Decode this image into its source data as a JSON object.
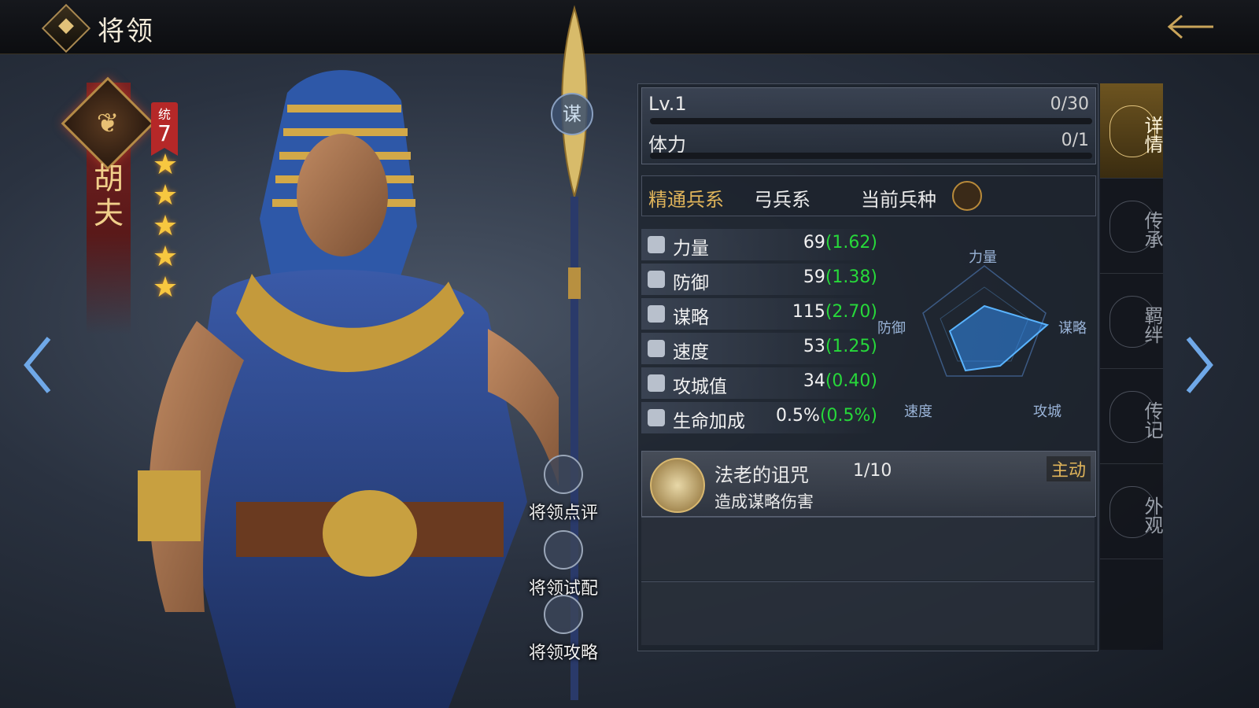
{
  "header": {
    "title": "将领",
    "back_icon": "arrow-left-icon"
  },
  "hero": {
    "name": "胡夫",
    "tong_label": "统",
    "tong_value": "7",
    "stars": 5,
    "skill_type_badge": "谋",
    "actions": [
      {
        "label": "将领点评",
        "icon": "comment-icon"
      },
      {
        "label": "将领试配",
        "icon": "helmet-icon"
      },
      {
        "label": "将领攻略",
        "icon": "book-icon"
      }
    ]
  },
  "level": {
    "label": "Lv.1",
    "exp": "0/30",
    "exp_fraction": 0
  },
  "stamina": {
    "label": "体力",
    "value": "0/1",
    "fraction": 0
  },
  "troop": {
    "mastery_label": "精通兵系",
    "mastery_value": "弓兵系",
    "current_label": "当前兵种",
    "current_icon": "bow-icon"
  },
  "stats": [
    {
      "name": "力量",
      "value": "69",
      "growth": "(1.62)",
      "icon": "fist-icon"
    },
    {
      "name": "防御",
      "value": "59",
      "growth": "(1.38)",
      "icon": "shield-icon"
    },
    {
      "name": "谋略",
      "value": "115",
      "growth": "(2.70)",
      "icon": "book-icon"
    },
    {
      "name": "速度",
      "value": "53",
      "growth": "(1.25)",
      "icon": "boot-icon"
    },
    {
      "name": "攻城值",
      "value": "34",
      "growth": "(0.40)",
      "icon": "ram-icon"
    },
    {
      "name": "生命加成",
      "value": "0.5%",
      "growth": "(0.5%)",
      "icon": "heart-shield-icon"
    }
  ],
  "radar": {
    "labels": {
      "top": "力量",
      "right": "谋略",
      "bottom_right": "攻城",
      "bottom_left": "速度",
      "left": "防御"
    }
  },
  "skill": {
    "name": "法老的诅咒",
    "level": "1/10",
    "description": "造成谋略伤害",
    "type": "主动",
    "icon": "pharaoh-skull-icon"
  },
  "tabs": [
    {
      "label": "详情",
      "active": true
    },
    {
      "label": "传承",
      "active": false
    },
    {
      "label": "羁绊",
      "active": false
    },
    {
      "label": "传记",
      "active": false
    },
    {
      "label": "外观",
      "active": false
    }
  ],
  "colors": {
    "accent_gold": "#d9b460",
    "growth_green": "#27d83a",
    "tong_red": "#b52828"
  }
}
